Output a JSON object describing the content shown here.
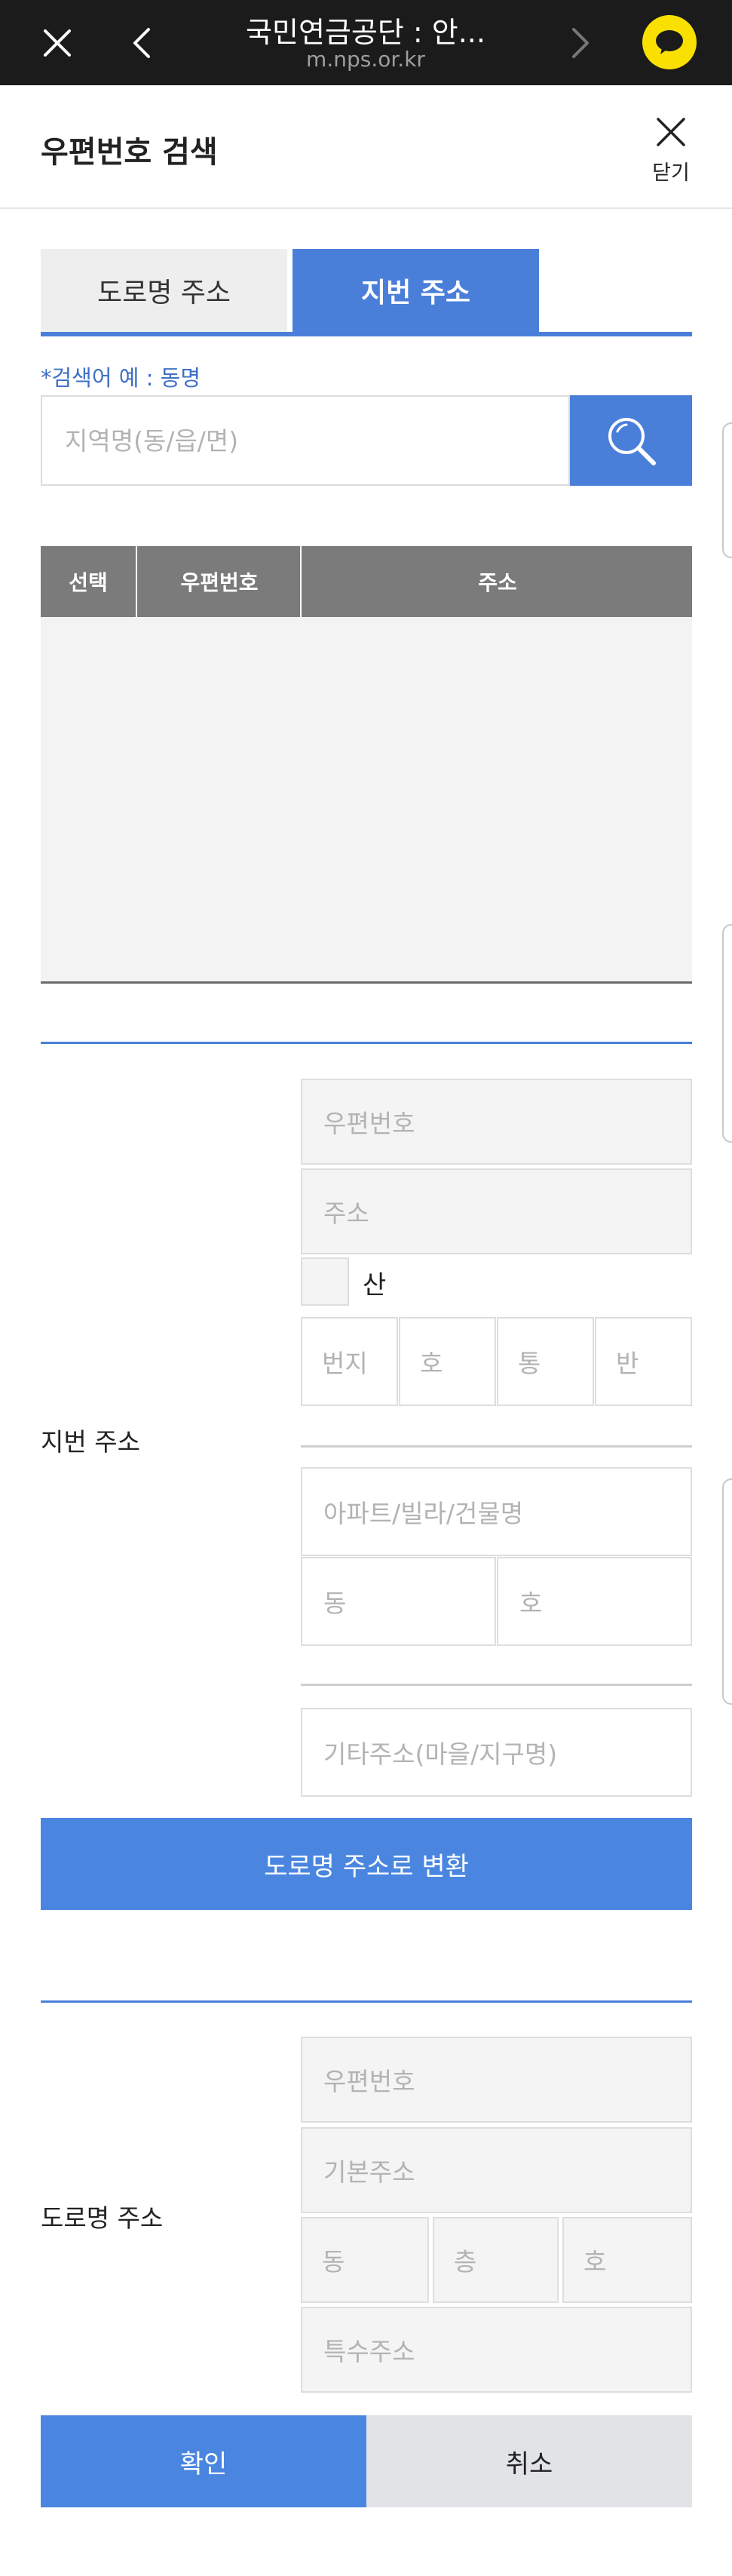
{
  "browser": {
    "title": "국민연금공단 : 안...",
    "url": "m.nps.or.kr"
  },
  "header": {
    "title": "우편번호 검색",
    "close_label": "닫기"
  },
  "tabs": [
    {
      "label": "도로명 주소",
      "active": false
    },
    {
      "label": "지번 주소",
      "active": true
    }
  ],
  "search": {
    "hint": "*검색어 예 : 동명",
    "placeholder": "지역명(동/읍/면)"
  },
  "results": {
    "columns": [
      "선택",
      "우편번호",
      "주소"
    ],
    "rows": []
  },
  "jibun_section": {
    "label": "지번 주소",
    "zip_placeholder": "우편번호",
    "address_placeholder": "주소",
    "mountain_label": "산",
    "bunji_placeholder": "번지",
    "ho_placeholder": "호",
    "tong_placeholder": "통",
    "ban_placeholder": "반",
    "building_placeholder": "아파트/빌라/건물명",
    "dong_placeholder": "동",
    "ho2_placeholder": "호",
    "etc_placeholder": "기타주소(마을/지구명)",
    "convert_button": "도로명 주소로 변환"
  },
  "road_section": {
    "label": "도로명 주소",
    "zip_placeholder": "우편번호",
    "base_placeholder": "기본주소",
    "dong_placeholder": "동",
    "floor_placeholder": "층",
    "ho_placeholder": "호",
    "special_placeholder": "특수주소"
  },
  "footer": {
    "confirm": "확인",
    "cancel": "취소"
  },
  "colors": {
    "accent": "#4a7fd9",
    "button": "#4a86e0",
    "table_header": "#7b7b7b",
    "topbar": "#1b1b1b",
    "kakao": "#f9e000"
  }
}
